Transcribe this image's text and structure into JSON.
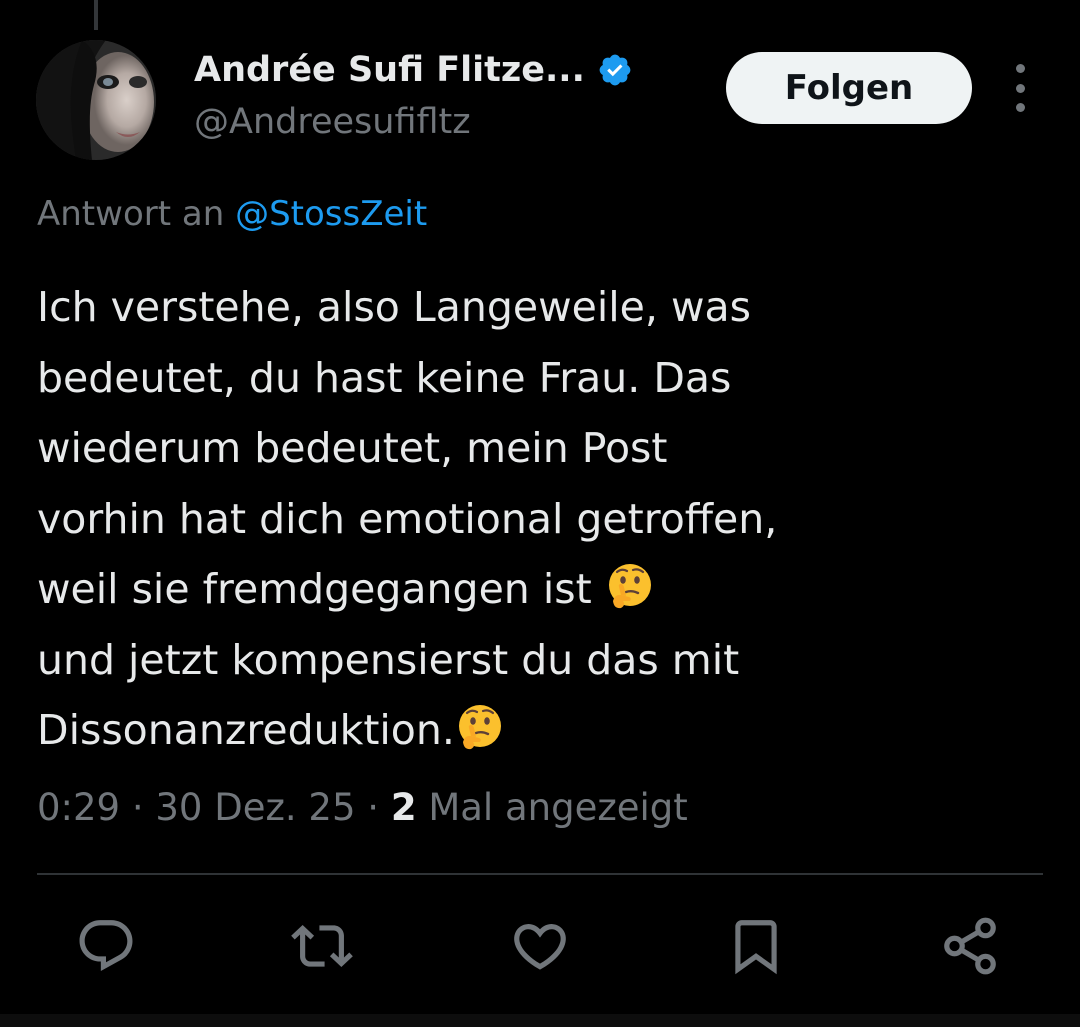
{
  "author": {
    "display_name": "Andrée Sufi Flitze...",
    "handle": "@Andreesufifltz",
    "verified": true
  },
  "follow_button": {
    "label": "Folgen"
  },
  "reply_context": {
    "prefix": "Antwort an",
    "mention": "@StossZeit"
  },
  "tweet": {
    "lines": [
      "Ich verstehe, also Langeweile, was",
      "bedeutet, du hast keine Frau. Das",
      "wiederum bedeutet, mein Post",
      "vorhin hat dich emotional getroffen,",
      "weil sie fremdgegangen ist ",
      "und jetzt kompensierst du das mit",
      "Dissonanzreduktion."
    ],
    "emoji": "thinking-face-icon"
  },
  "meta": {
    "time": "0:29",
    "date": "30 Dez. 25",
    "views_count": "2",
    "views_label": "Mal angezeigt",
    "separator": "·"
  },
  "actions": [
    "reply-icon",
    "retweet-icon",
    "like-icon",
    "bookmark-icon",
    "share-icon"
  ],
  "colors": {
    "background": "#000000",
    "text": "#e7e9ea",
    "secondary": "#71767b",
    "accent": "#1d9bf0",
    "divider": "#2f3336"
  }
}
